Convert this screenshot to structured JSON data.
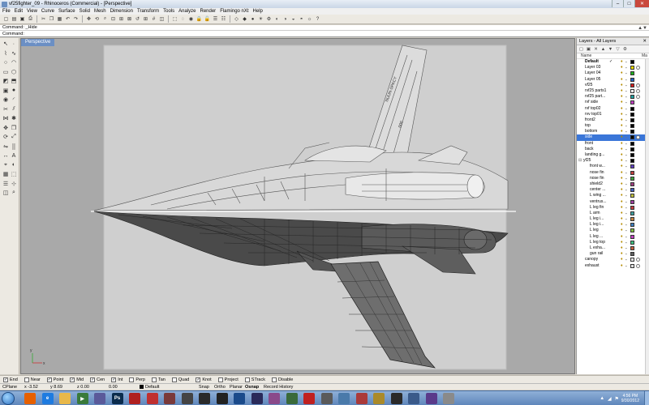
{
  "window": {
    "title": "vf25fighter_09 - Rhinoceros (Commercial) - [Perspective]",
    "controls": {
      "minimize": "–",
      "maximize": "□",
      "close": "✕"
    }
  },
  "menu": [
    "File",
    "Edit",
    "View",
    "Curve",
    "Surface",
    "Solid",
    "Mesh",
    "Dimension",
    "Transform",
    "Tools",
    "Analyze",
    "Render",
    "Flamingo nXt",
    "Help"
  ],
  "toolbar_icons": [
    "new-icon",
    "open-icon",
    "save-icon",
    "print-icon",
    "cut-icon",
    "copy-icon",
    "paste-icon",
    "undo-icon",
    "redo-icon",
    "pan-icon",
    "rotate-view-icon",
    "zoom-icon",
    "zoom-window-icon",
    "zoom-extents-icon",
    "zoom-selected-icon",
    "undo-view-icon",
    "four-views-icon",
    "grid-icon",
    "cplane-icon",
    "select-icon",
    "hide-icon",
    "show-icon",
    "lock-icon",
    "unlock-icon",
    "layer-icon",
    "properties-icon",
    "wireframe-icon",
    "shaded-icon",
    "rendered-icon",
    "light-icon",
    "options-icon",
    "render-icon",
    "material-icon",
    "environment-icon",
    "camera-icon",
    "sun-icon",
    "help-icon"
  ],
  "command": {
    "history": "Command: _Hide",
    "prompt": "Command:",
    "value": ""
  },
  "viewport": {
    "label": "Perspective",
    "art_text": {
      "wing_text": "NUUN-SPACY",
      "tail_number": "000"
    },
    "axes": {
      "x": "x",
      "y": "y",
      "z": "z"
    }
  },
  "layers_panel": {
    "title": "Layers - All Layers",
    "header": {
      "name": "Name",
      "mat": "Ma"
    },
    "rows": [
      {
        "name": "Default",
        "bold": true,
        "indent": 1,
        "check": "✓",
        "color": "#000000",
        "mat": false
      },
      {
        "name": "Layer 03",
        "indent": 1,
        "color": "#e8d800",
        "mat": true
      },
      {
        "name": "Layer 04",
        "indent": 1,
        "color": "#20b020",
        "mat": false
      },
      {
        "name": "Layer 05",
        "indent": 1,
        "color": "#2060c0",
        "mat": false
      },
      {
        "name": "vf25",
        "indent": 1,
        "color": "#d02020",
        "mat": true
      },
      {
        "name": "rvf25 parts1",
        "indent": 1,
        "color": "#ffffff",
        "mat": true
      },
      {
        "name": "rvf25 part...",
        "indent": 1,
        "color": "#20a0a0",
        "mat": true
      },
      {
        "name": "rvf side",
        "indent": 1,
        "color": "#c040c0",
        "mat": false
      },
      {
        "name": "rvf top02",
        "indent": 1,
        "color": "#000000",
        "mat": false
      },
      {
        "name": "rvv top01",
        "indent": 1,
        "color": "#000000",
        "mat": false
      },
      {
        "name": "front2",
        "indent": 1,
        "color": "#000000",
        "mat": false
      },
      {
        "name": "top",
        "indent": 1,
        "color": "#000000",
        "mat": false
      },
      {
        "name": "bottom",
        "indent": 1,
        "color": "#000000",
        "mat": false
      },
      {
        "name": "side",
        "indent": 1,
        "color": "#000000",
        "mat": true,
        "selected": true
      },
      {
        "name": "front",
        "indent": 1,
        "color": "#000000",
        "mat": false
      },
      {
        "name": "back",
        "indent": 1,
        "color": "#000000",
        "mat": false
      },
      {
        "name": "landing g...",
        "indent": 1,
        "color": "#000000",
        "mat": false
      },
      {
        "name": "yf25",
        "indent": 0,
        "expander": "⊟",
        "color": "#000000",
        "mat": false
      },
      {
        "name": "front w...",
        "indent": 2,
        "color": "#6040c0",
        "mat": false
      },
      {
        "name": "nose fin",
        "indent": 2,
        "color": "#c04040",
        "mat": false
      },
      {
        "name": "nose fin",
        "indent": 2,
        "color": "#40a040",
        "mat": false
      },
      {
        "name": "shield2",
        "indent": 2,
        "color": "#a04080",
        "mat": false
      },
      {
        "name": "center ...",
        "indent": 2,
        "color": "#4060c0",
        "mat": false
      },
      {
        "name": "L wing ...",
        "indent": 2,
        "color": "#c0c040",
        "mat": false
      },
      {
        "name": "ventrus...",
        "indent": 2,
        "color": "#a040a0",
        "mat": false
      },
      {
        "name": "L leg fin",
        "indent": 2,
        "color": "#c04040",
        "mat": false
      },
      {
        "name": "L arm",
        "indent": 2,
        "color": "#40a0a0",
        "mat": false
      },
      {
        "name": "L leg i...",
        "indent": 2,
        "color": "#c08040",
        "mat": false
      },
      {
        "name": "L leg i...",
        "indent": 2,
        "color": "#4080c0",
        "mat": false
      },
      {
        "name": "L leg",
        "indent": 2,
        "color": "#80c040",
        "mat": false
      },
      {
        "name": "L leg ...",
        "indent": 2,
        "color": "#c040c0",
        "mat": false
      },
      {
        "name": "L leg top",
        "indent": 2,
        "color": "#40c080",
        "mat": false
      },
      {
        "name": "L exha...",
        "indent": 2,
        "color": "#c06040",
        "mat": false
      },
      {
        "name": "gun rail",
        "indent": 2,
        "color": "#606060",
        "mat": false
      },
      {
        "name": "canopy",
        "indent": 1,
        "color": "#e0e0e0",
        "mat": true
      },
      {
        "name": "exhaust",
        "indent": 1,
        "color": "#e0e0e0",
        "mat": true
      }
    ]
  },
  "osnaps": [
    {
      "label": "End",
      "checked": true
    },
    {
      "label": "Near",
      "checked": false
    },
    {
      "label": "Point",
      "checked": true
    },
    {
      "label": "Mid",
      "checked": true
    },
    {
      "label": "Cen",
      "checked": true
    },
    {
      "label": "Int",
      "checked": true
    },
    {
      "label": "Perp",
      "checked": false
    },
    {
      "label": "Tan",
      "checked": false
    },
    {
      "label": "Quad",
      "checked": false
    },
    {
      "label": "Knot",
      "checked": true
    },
    {
      "label": "Project",
      "checked": false
    },
    {
      "label": "STrack",
      "checked": false
    },
    {
      "label": "Disable",
      "checked": false
    }
  ],
  "status": {
    "cplane": "CPlane",
    "x": "x -3.52",
    "y": "y 8.69",
    "z": "z 0.00",
    "dist": "0.00",
    "layer": "Default",
    "snap": "Snap",
    "ortho": "Ortho",
    "planar": "Planar",
    "osnap": "Osnap",
    "record": "Record History"
  },
  "taskbar": {
    "apps": [
      {
        "name": "firefox-icon",
        "glyph": "",
        "color": "#e66000"
      },
      {
        "name": "ie-icon",
        "glyph": "e",
        "color": "#1e7be0"
      },
      {
        "name": "explorer-icon",
        "glyph": "",
        "color": "#e8b84a"
      },
      {
        "name": "media-player-icon",
        "glyph": "▶",
        "color": "#3a7a3a"
      },
      {
        "name": "app-icon",
        "glyph": "",
        "color": "#5a5a9a"
      },
      {
        "name": "photoshop-icon",
        "glyph": "Ps",
        "color": "#0b2c4d"
      },
      {
        "name": "app-icon",
        "glyph": "",
        "color": "#b02020"
      },
      {
        "name": "sketchup-icon",
        "glyph": "",
        "color": "#c03030"
      },
      {
        "name": "app-icon",
        "glyph": "",
        "color": "#7a3a3a"
      },
      {
        "name": "zbrush-icon",
        "glyph": "",
        "color": "#444"
      },
      {
        "name": "keyshot-icon",
        "glyph": "",
        "color": "#2a2a2a"
      },
      {
        "name": "app-icon",
        "glyph": "",
        "color": "#222"
      },
      {
        "name": "app-icon",
        "glyph": "",
        "color": "#1a4a8a"
      },
      {
        "name": "app-icon",
        "glyph": "",
        "color": "#2a2a5a"
      },
      {
        "name": "app-icon",
        "glyph": "",
        "color": "#8a4a8a"
      },
      {
        "name": "app-icon",
        "glyph": "",
        "color": "#3a6a3a"
      },
      {
        "name": "app-icon",
        "glyph": "",
        "color": "#c02020"
      },
      {
        "name": "app-icon",
        "glyph": "",
        "color": "#5a5a5a"
      },
      {
        "name": "app-icon",
        "glyph": "",
        "color": "#4a7aaa"
      },
      {
        "name": "app-icon",
        "glyph": "",
        "color": "#aa3a3a"
      },
      {
        "name": "app-icon",
        "glyph": "",
        "color": "#aa8a2a"
      },
      {
        "name": "app-icon",
        "glyph": "",
        "color": "#2a2a2a"
      },
      {
        "name": "app-icon",
        "glyph": "",
        "color": "#3a5a8a"
      },
      {
        "name": "app-icon",
        "glyph": "",
        "color": "#5a3a8a"
      },
      {
        "name": "app-icon",
        "glyph": "",
        "color": "#8a8a8a"
      }
    ],
    "time": "4:56 PM",
    "date": "9/30/2012"
  }
}
